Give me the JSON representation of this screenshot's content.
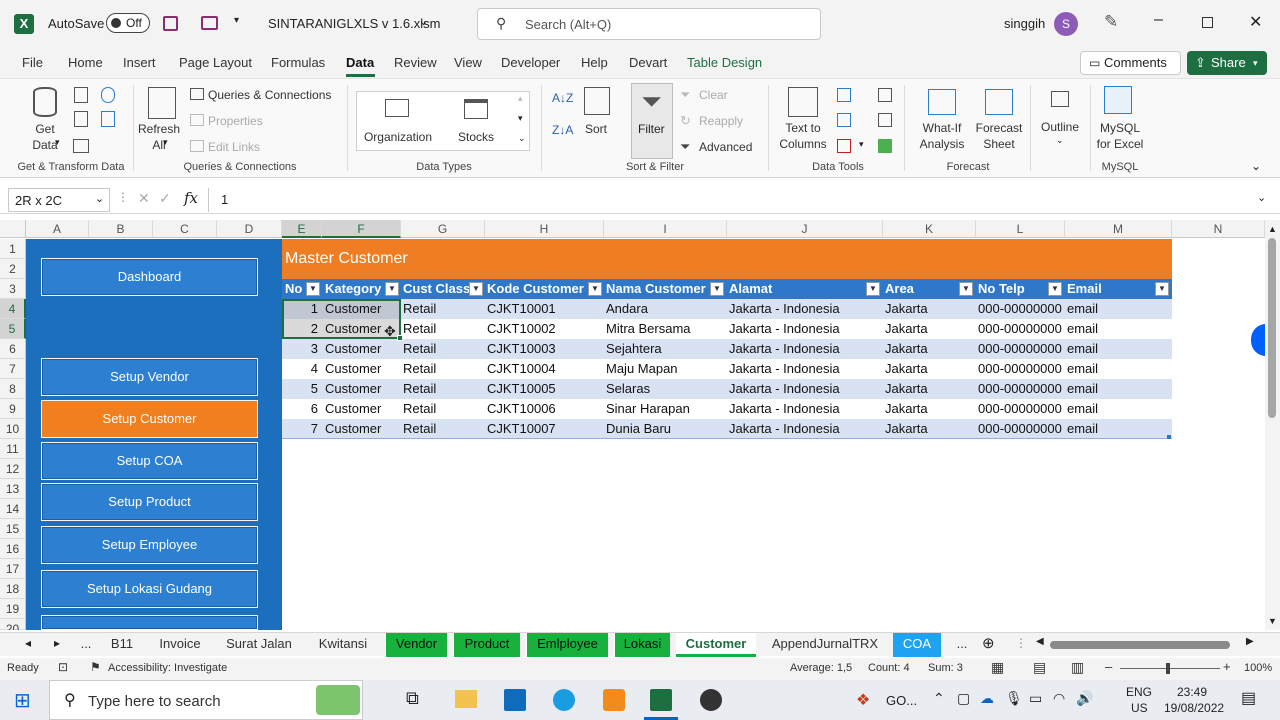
{
  "titlebar": {
    "autosave_label": "AutoSave",
    "autosave_state": "Off",
    "filename": "SINTARANIGLXLS v 1.6.xlsm",
    "search_placeholder": "Search (Alt+Q)",
    "user_name": "singgih",
    "user_initial": "S"
  },
  "ribbon_tabs": [
    "File",
    "Home",
    "Insert",
    "Page Layout",
    "Formulas",
    "Data",
    "Review",
    "View",
    "Developer",
    "Help",
    "Devart",
    "Table Design"
  ],
  "comments_label": "Comments",
  "share_label": "Share",
  "ribbon": {
    "get_data": "Get Data",
    "refresh_all": "Refresh All",
    "queries_connections": "Queries & Connections",
    "properties": "Properties",
    "edit_links": "Edit Links",
    "organization": "Organization",
    "stocks": "Stocks",
    "sort": "Sort",
    "filter": "Filter",
    "clear": "Clear",
    "reapply": "Reapply",
    "advanced": "Advanced",
    "text_to_columns": "Text to Columns",
    "what_if": "What-If Analysis",
    "forecast_sheet": "Forecast Sheet",
    "outline": "Outline",
    "mysql": "MySQL for Excel",
    "groups": {
      "get_transform": "Get & Transform Data",
      "queries": "Queries & Connections",
      "data_types": "Data Types",
      "sort_filter": "Sort & Filter",
      "data_tools": "Data Tools",
      "forecast": "Forecast",
      "mysql": "MySQL"
    }
  },
  "formula_bar": {
    "name_box": "2R x 2C",
    "formula": "1"
  },
  "columns": [
    "A",
    "B",
    "C",
    "D",
    "E",
    "F",
    "G",
    "H",
    "I",
    "J",
    "K",
    "L",
    "M",
    "N"
  ],
  "rows": [
    "1",
    "2",
    "3",
    "4",
    "5",
    "6",
    "7",
    "8",
    "9",
    "10",
    "11",
    "12",
    "13",
    "14",
    "15",
    "16",
    "17",
    "18",
    "19",
    "20"
  ],
  "nav_buttons": [
    "Dashboard",
    "Setup Vendor",
    "Setup Customer",
    "Setup COA",
    "Setup Product",
    "Setup Employee",
    "Setup Lokasi Gudang"
  ],
  "table_title": "Master Customer",
  "table_headers": [
    "No",
    "Kategory",
    "Cust Class",
    "Kode Customer",
    "Nama Customer",
    "Alamat",
    "Area",
    "No Telp",
    "Email"
  ],
  "table_rows": [
    [
      "1",
      "Customer",
      "Retail",
      "CJKT10001",
      "Andara",
      "Jakarta - Indonesia",
      "Jakarta",
      "000-00000000",
      "email"
    ],
    [
      "2",
      "Customer",
      "Retail",
      "CJKT10002",
      "Mitra Bersama",
      "Jakarta - Indonesia",
      "Jakarta",
      "000-00000000",
      "email"
    ],
    [
      "3",
      "Customer",
      "Retail",
      "CJKT10003",
      "Sejahtera",
      "Jakarta - Indonesia",
      "Jakarta",
      "000-00000000",
      "email"
    ],
    [
      "4",
      "Customer",
      "Retail",
      "CJKT10004",
      "Maju Mapan",
      "Jakarta - Indonesia",
      "Jakarta",
      "000-00000000",
      "email"
    ],
    [
      "5",
      "Customer",
      "Retail",
      "CJKT10005",
      "Selaras",
      "Jakarta - Indonesia",
      "Jakarta",
      "000-00000000",
      "email"
    ],
    [
      "6",
      "Customer",
      "Retail",
      "CJKT10006",
      "Sinar Harapan",
      "Jakarta - Indonesia",
      "Jakarta",
      "000-00000000",
      "email"
    ],
    [
      "7",
      "Customer",
      "Retail",
      "CJKT10007",
      "Dunia Baru",
      "Jakarta - Indonesia",
      "Jakarta",
      "000-00000000",
      "email"
    ]
  ],
  "sheet_tabs": [
    "...",
    "B11",
    "Invoice",
    "Surat Jalan",
    "Kwitansi",
    "Vendor",
    "Product",
    "Emlployee",
    "Lokasi",
    "Customer",
    "AppendJurnalTRX",
    "COA",
    "..."
  ],
  "status": {
    "ready": "Ready",
    "accessibility": "Accessibility: Investigate",
    "average": "Average: 1,5",
    "count": "Count: 4",
    "sum": "Sum: 3",
    "zoom": "100%"
  },
  "taskbar": {
    "search_placeholder": "Type here to search",
    "weather": "GO...",
    "lang1": "ENG",
    "lang2": "US",
    "time": "23:49",
    "date": "19/08/2022"
  },
  "colors": {
    "nav_blue": "#2c7fd1",
    "nav_active": "#f07f1f",
    "table_header": "#2f78c9",
    "title_orange": "#ee7d23",
    "excel_green": "#1d6f42",
    "sheet_green": "#19b13d"
  }
}
